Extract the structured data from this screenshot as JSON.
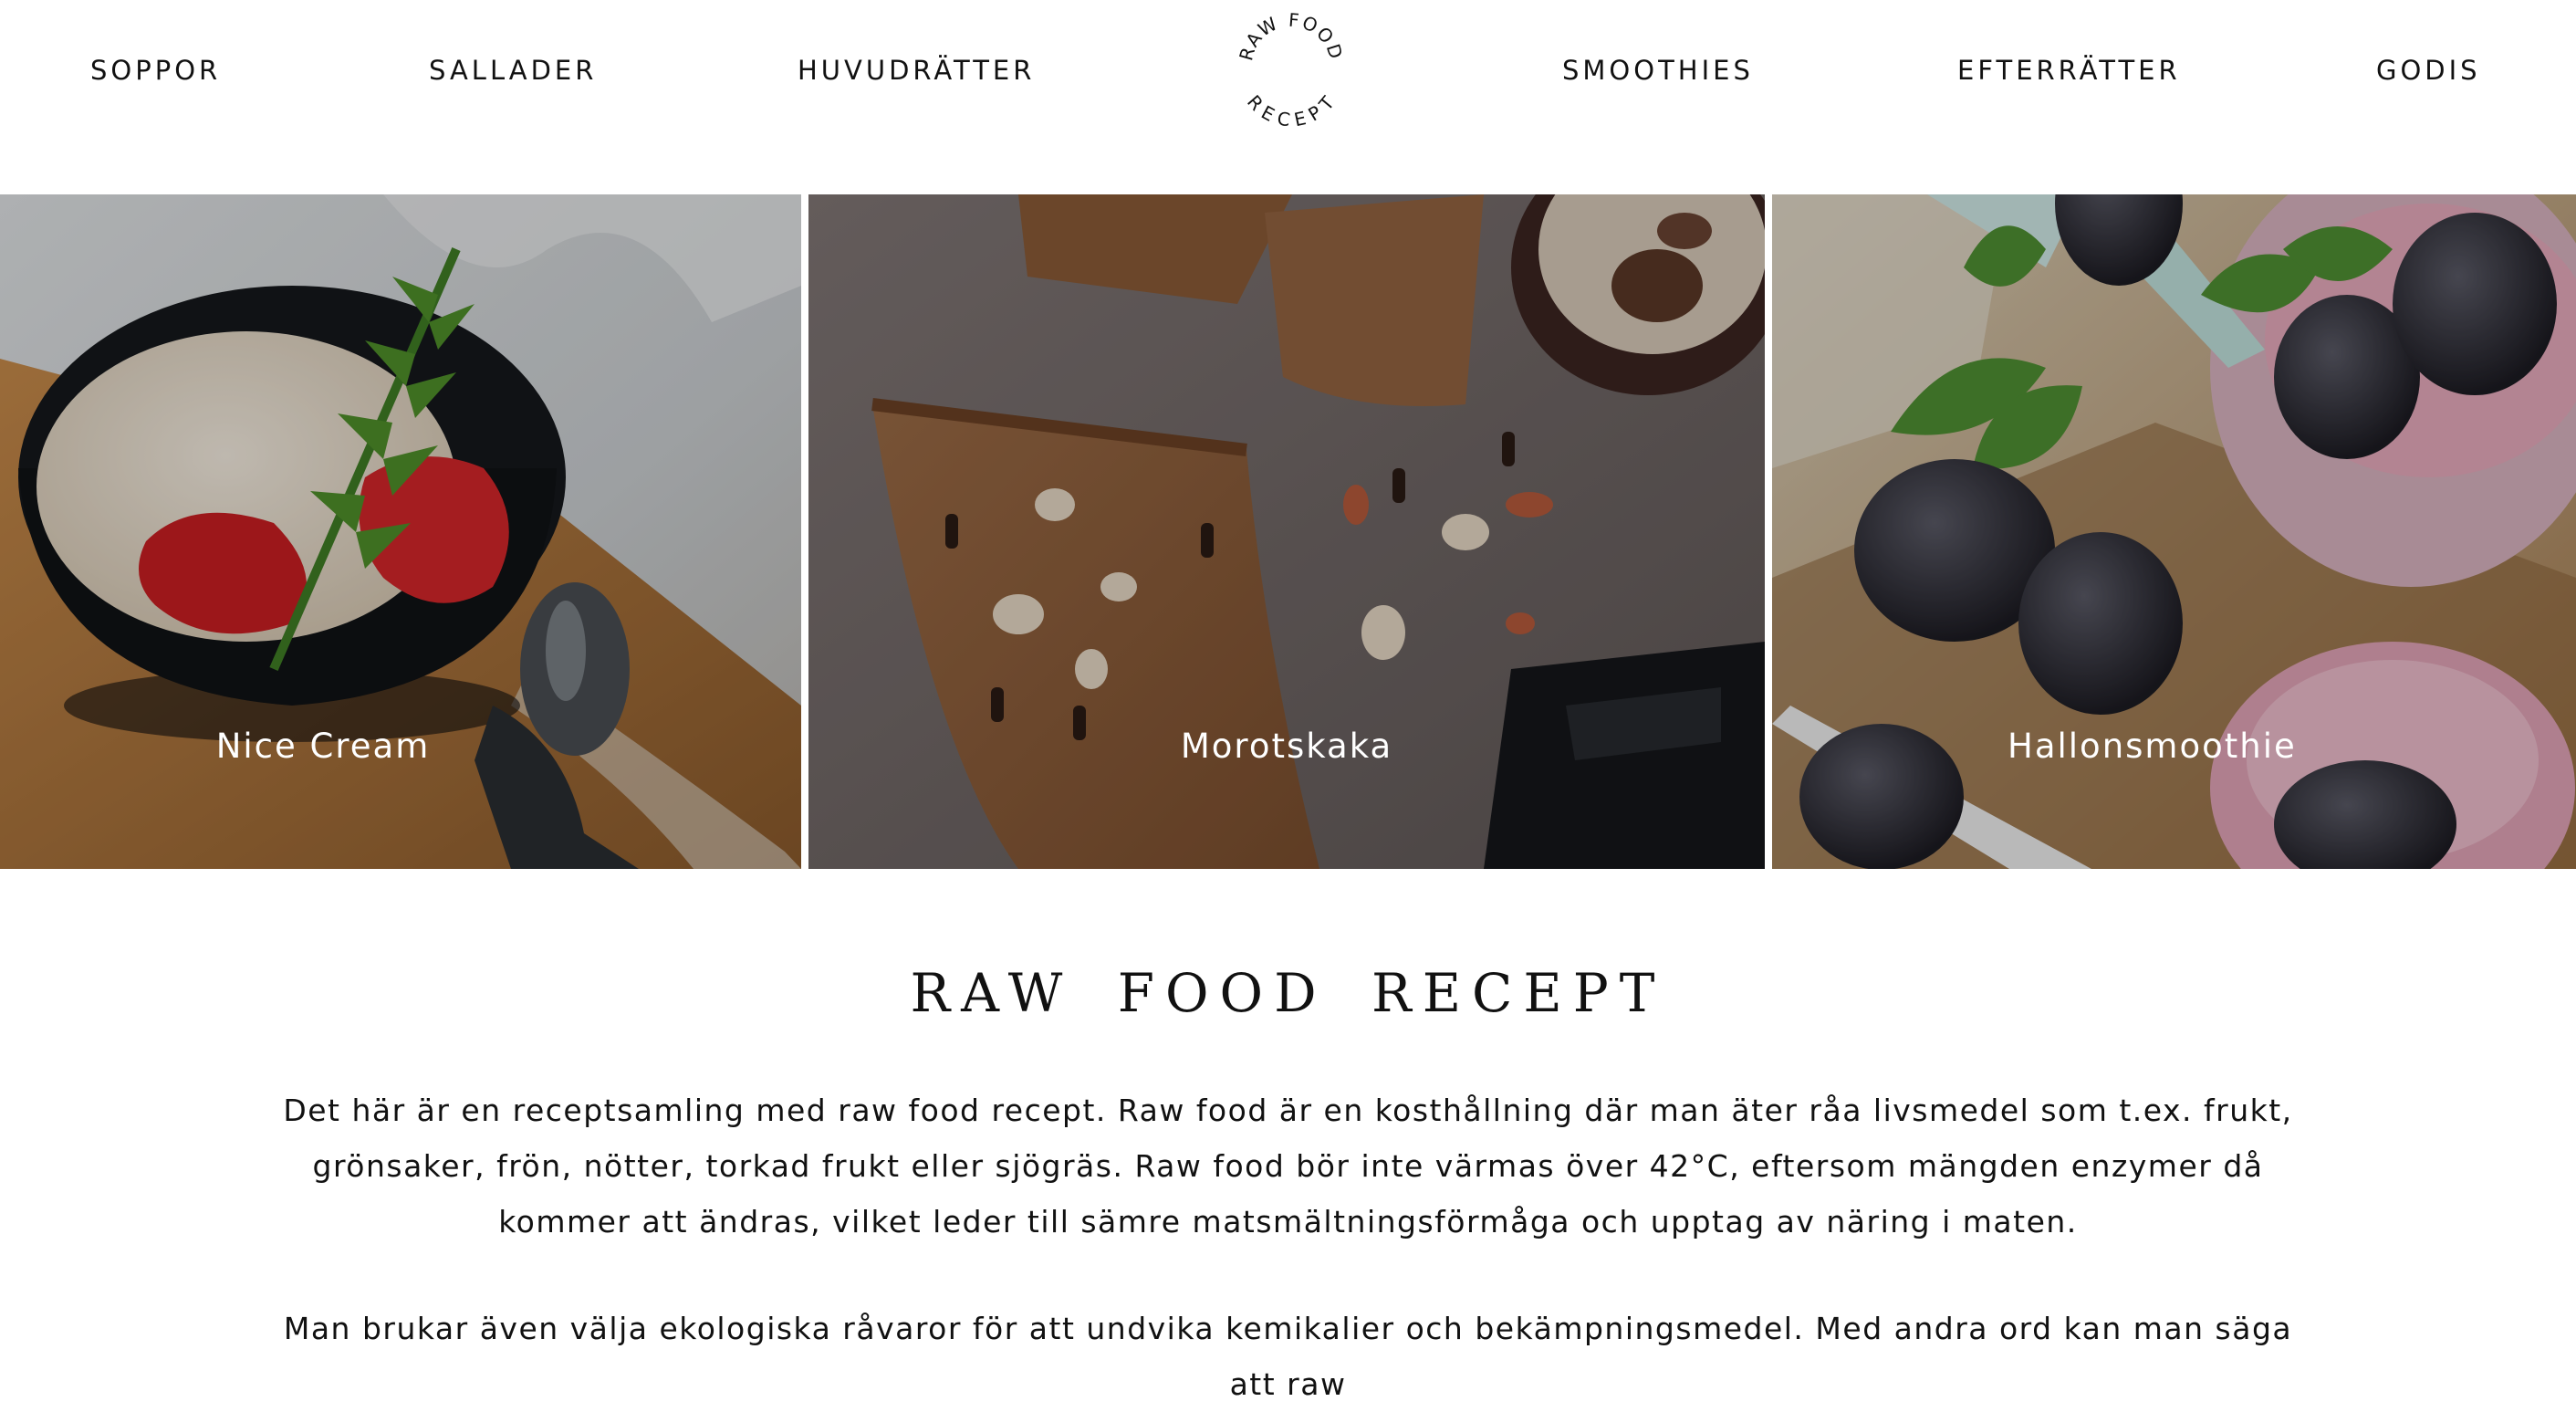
{
  "nav": {
    "items": [
      {
        "label": "SOPPOR"
      },
      {
        "label": "SALLADER"
      },
      {
        "label": "HUVUDRÄTTER"
      },
      {
        "label": "SMOOTHIES"
      },
      {
        "label": "EFTERRÄTTER"
      },
      {
        "label": "GODIS"
      }
    ],
    "logo": {
      "top_text": "RAW FOOD",
      "bottom_text": "RECEPT"
    }
  },
  "featured": [
    {
      "label": "Nice Cream"
    },
    {
      "label": "Morotskaka"
    },
    {
      "label": "Hallonsmoothie"
    }
  ],
  "main": {
    "title": "RAW FOOD RECEPT",
    "paragraphs": [
      "Det här är en receptsamling med raw food recept. Raw food är en kosthållning där man äter råa livsmedel som t.ex. frukt, grönsaker, frön, nötter, torkad frukt eller sjögräs. Raw food bör inte värmas över 42°C, eftersom mängden enzymer då kommer att ändras, vilket leder till sämre matsmältningsförmåga och upptag av näring i maten.",
      "Man brukar även välja ekologiska råvaror för att undvika kemikalier och bekämpningsmedel. Med andra ord kan man säga att raw"
    ]
  },
  "colors": {
    "text": "#111111",
    "background": "#ffffff",
    "overlay_text": "#ffffff"
  }
}
